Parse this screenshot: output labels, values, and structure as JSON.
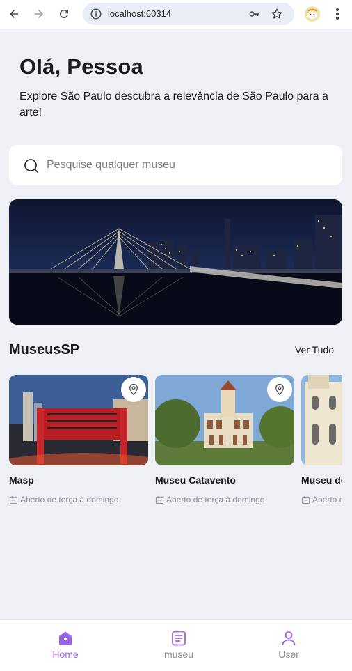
{
  "browser": {
    "url": "localhost:60314"
  },
  "header": {
    "greeting": "Olá, Pessoa",
    "subtitle": "Explore São Paulo descubra a relevância de São Paulo para a arte!"
  },
  "search": {
    "placeholder": "Pesquise qualquer museu",
    "value": ""
  },
  "museums_section": {
    "title": "MuseusSP",
    "see_all_label": "Ver Tudo",
    "cards": [
      {
        "name": "Masp",
        "hours": "Aberto de terça à domingo"
      },
      {
        "name": "Museu Catavento",
        "hours": "Aberto de terça à domingo"
      },
      {
        "name": "Museu do Ipiranga",
        "hours": "Aberto de terça à domingo"
      }
    ]
  },
  "bottom_nav": {
    "items": [
      {
        "label": "Home",
        "icon": "home-icon",
        "active": true
      },
      {
        "label": "museu",
        "icon": "book-icon",
        "active": false
      },
      {
        "label": "User",
        "icon": "user-icon",
        "active": false
      }
    ]
  },
  "colors": {
    "accent": "#9b62e6",
    "background": "#eef0f6",
    "muted_text": "#8a8c93"
  }
}
